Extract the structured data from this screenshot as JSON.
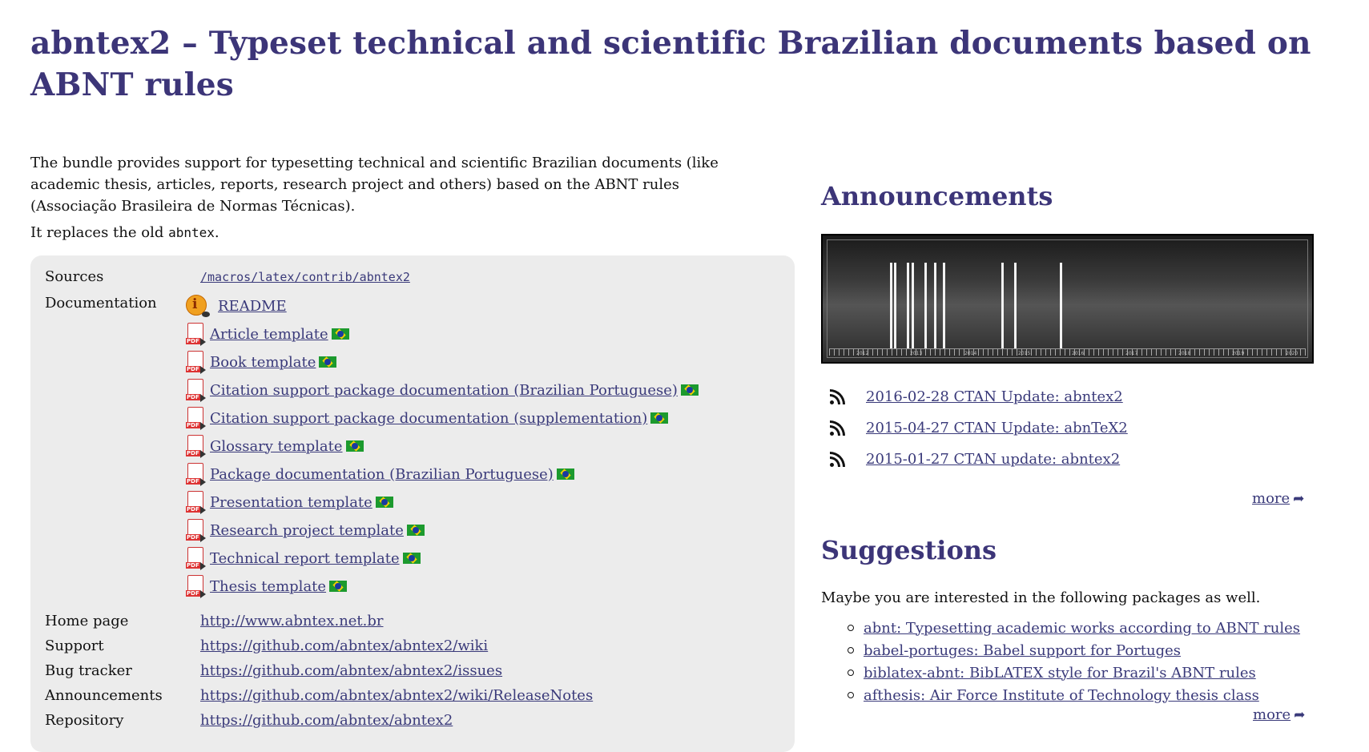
{
  "page": {
    "title": "abntex2 – Typeset technical and scientific Brazilian documents based on ABNT rules",
    "description": "The bundle provides support for typesetting technical and scientific Brazilian documents (like academic thesis, articles, reports, research project and others) based on the ABNT rules (Associação Brasileira de Normas Técnicas).",
    "replaces_prefix": "It replaces the old ",
    "replaces_code": "abntex",
    "replaces_suffix": "."
  },
  "info": {
    "sources_label": "Sources",
    "sources_value": "/macros/latex/contrib/abntex2",
    "documentation_label": "Documentation",
    "readme": "README",
    "docs": [
      "Article template",
      "Book template",
      "Citation support package documentation (Brazilian Portuguese)",
      "Citation support package documentation (supplementation)",
      "Glossary template",
      "Package documentation (Brazilian Portuguese)",
      "Presentation template",
      "Research project template",
      "Technical report template",
      "Thesis template"
    ],
    "home_label": "Home page",
    "home_value": "http://www.abntex.net.br",
    "support_label": "Support",
    "support_value": "https://github.com/abntex/abntex2/wiki",
    "bug_label": "Bug tracker",
    "bug_value": "https://github.com/abntex/abntex2/issues",
    "announcements_label": "Announcements",
    "announcements_value": "https://github.com/abntex/abntex2/wiki/ReleaseNotes",
    "repository_label": "Repository",
    "repository_value": "https://github.com/abntex/abntex2"
  },
  "announcements": {
    "heading": "Announcements",
    "timeline_years": [
      "2012",
      "2013",
      "2014",
      "2015",
      "2016",
      "2017",
      "2018",
      "2019",
      "2020"
    ],
    "items": [
      "2016-02-28 CTAN Update: abntex2",
      "2015-04-27 CTAN Update: abnTeX2",
      "2015-01-27 CTAN update: abntex2"
    ],
    "more": "more"
  },
  "suggestions": {
    "heading": "Suggestions",
    "intro": "Maybe you are interested in the following packages as well.",
    "items": [
      "abnt: Typesetting academic works according to ABNT rules",
      "babel-portuges: Babel support for Portuges",
      "biblatex-abnt: BibLATEX style for Brazil's ABNT rules",
      "afthesis: Air Force Institute of Technology thesis class"
    ],
    "more": "more"
  },
  "colors": {
    "heading": "#3c3578",
    "link": "#3a3a7a",
    "box_bg": "#ececec"
  }
}
